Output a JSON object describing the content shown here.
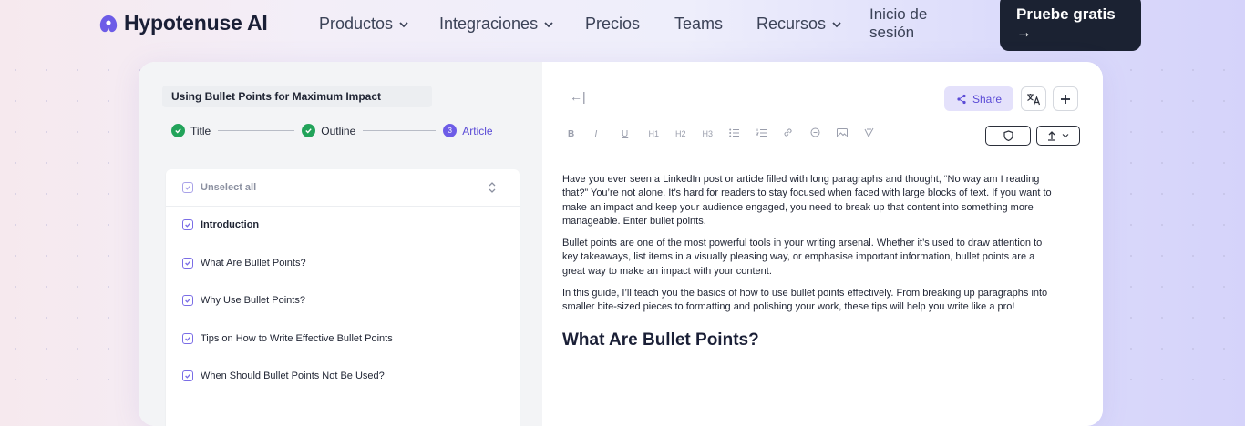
{
  "nav": {
    "brand": "Hypotenuse AI",
    "items": [
      {
        "label": "Productos",
        "has_dropdown": true
      },
      {
        "label": "Integraciones",
        "has_dropdown": true
      },
      {
        "label": "Precios",
        "has_dropdown": false
      },
      {
        "label": "Teams",
        "has_dropdown": false
      },
      {
        "label": "Recursos",
        "has_dropdown": true
      }
    ],
    "login": "Inicio de sesión",
    "cta": "Pruebe gratis →"
  },
  "editor": {
    "doc_title": "Using Bullet Points for Maximum Impact",
    "steps": [
      {
        "label": "Title",
        "state": "done"
      },
      {
        "label": "Outline",
        "state": "done"
      },
      {
        "label": "Article",
        "state": "active",
        "number": "3"
      }
    ],
    "outline": {
      "unselect_label": "Unselect all",
      "items": [
        {
          "label": "Introduction",
          "checked": true,
          "bold": true
        },
        {
          "label": "What Are Bullet Points?",
          "checked": true
        },
        {
          "label": "Why Use Bullet Points?",
          "checked": true
        },
        {
          "label": "Tips on How to Write Effective Bullet Points",
          "checked": true
        },
        {
          "label": "When Should Bullet Points Not Be Used?",
          "checked": true
        }
      ]
    },
    "toolbar": {
      "back": "←|",
      "share": "Share",
      "format_buttons": [
        "B",
        "I",
        "U",
        "H1",
        "H2",
        "H3",
        "bullet-list",
        "numbered-list",
        "link",
        "unlink",
        "image",
        "clear-format"
      ]
    },
    "article": {
      "paragraphs": [
        "Have you ever seen a LinkedIn post or article filled with long paragraphs and thought, “No way am I reading that?” You’re not alone. It’s hard for readers to stay focused when faced with large blocks of text. If you want to make an impact and keep your audience engaged, you need to break up that content into something more manageable. Enter bullet points.",
        "Bullet points are one of the most powerful tools in your writing arsenal. Whether it’s used to draw attention to key takeaways, list items in a visually pleasing way, or emphasise important information, bullet points are a great way to make an impact with your content.",
        "In this guide, I’ll teach you the basics of how to use bullet points effectively. From breaking up paragraphs into smaller bite-sized pieces to formatting and polishing your work, these tips will help you write like a pro!"
      ],
      "heading": "What Are Bullet Points?"
    }
  },
  "colors": {
    "accent": "#5b4bd6",
    "check_green": "#22a35a",
    "cta_bg": "#1b2232"
  }
}
